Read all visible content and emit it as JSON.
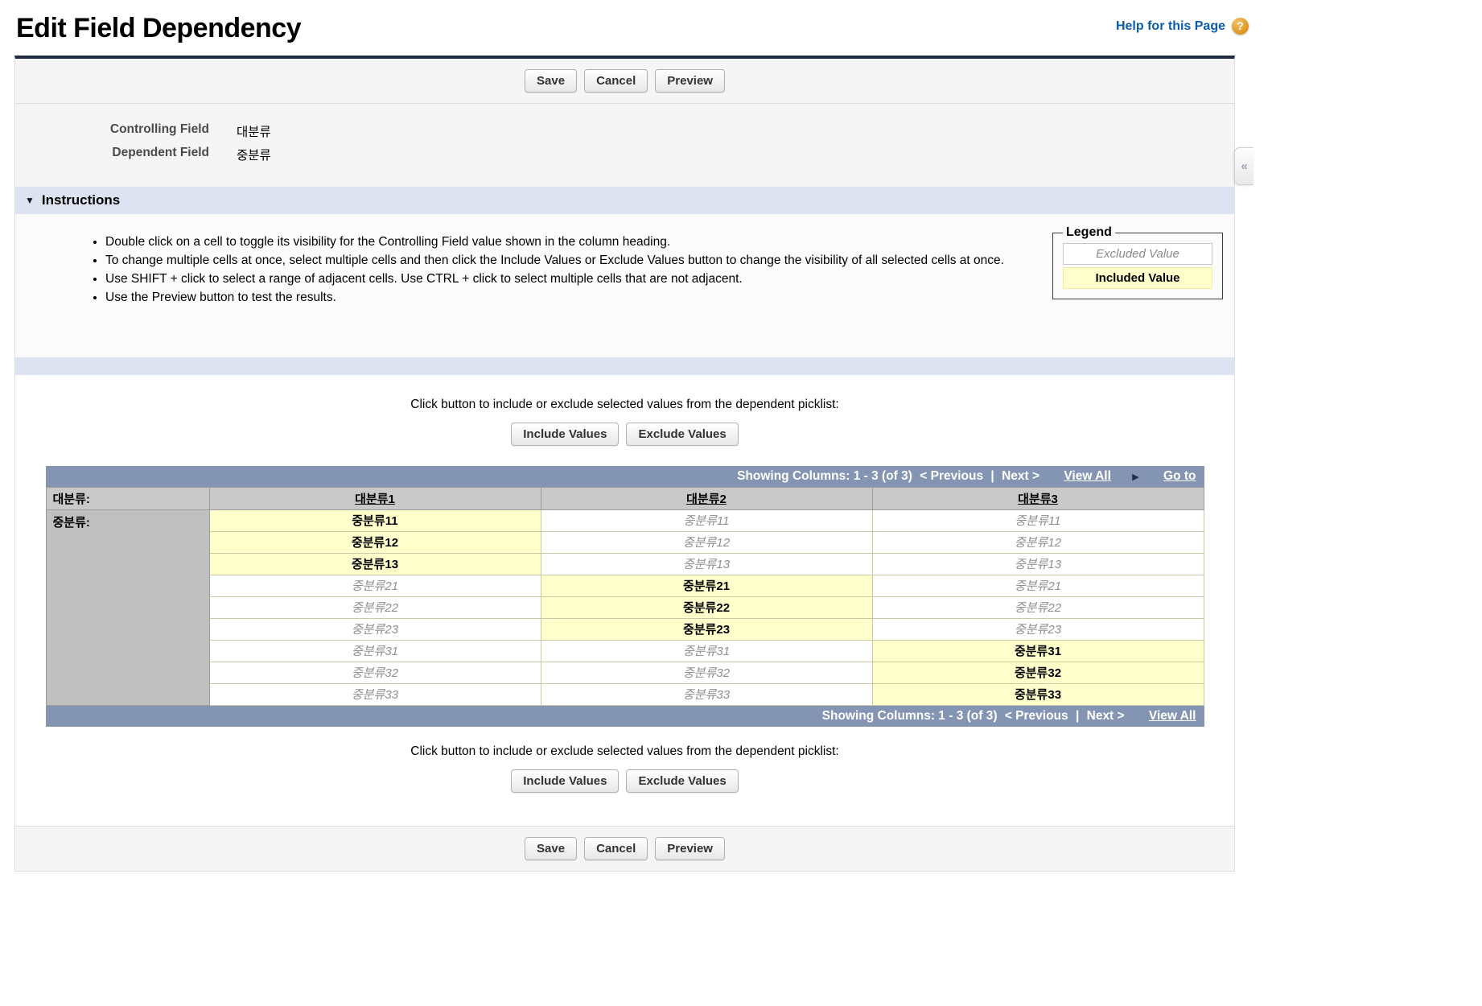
{
  "page": {
    "title": "Edit Field Dependency",
    "help_link": "Help for this Page",
    "help_icon": "?"
  },
  "buttons": {
    "save": "Save",
    "cancel": "Cancel",
    "preview": "Preview",
    "include": "Include Values",
    "exclude": "Exclude Values"
  },
  "fields": {
    "controlling_label": "Controlling Field",
    "controlling_value": "대분류",
    "dependent_label": "Dependent Field",
    "dependent_value": "중분류"
  },
  "instructions": {
    "header": "Instructions",
    "collapse_icon": "▼",
    "bullets": [
      "Double click on a cell to toggle its visibility for the Controlling Field value shown in the column heading.",
      "To change multiple cells at once, select multiple cells and then click the Include Values or Exclude Values button to change the visibility of all selected cells at once.",
      "Use SHIFT + click to select a range of adjacent cells. Use CTRL + click to select multiple cells that are not adjacent.",
      "Use the Preview button to test the results."
    ]
  },
  "legend": {
    "title": "Legend",
    "excluded": "Excluded Value",
    "included": "Included Value"
  },
  "picklist_prompt": "Click button to include or exclude selected values from the dependent picklist:",
  "table": {
    "showing": "Showing Columns: 1 - 3 (of 3)",
    "previous": "< Previous",
    "divider": "|",
    "next": "Next >",
    "view_all": "View All",
    "go_to": "Go to",
    "go_to_icon": "▶",
    "controlling_row_label": "대분류:",
    "dependent_row_label": "중분류:",
    "columns": [
      "대분류1",
      "대분류2",
      "대분류3"
    ],
    "rows": [
      {
        "value": "중분류11",
        "included": 0
      },
      {
        "value": "중분류12",
        "included": 0
      },
      {
        "value": "중분류13",
        "included": 0
      },
      {
        "value": "중분류21",
        "included": 1
      },
      {
        "value": "중분류22",
        "included": 1
      },
      {
        "value": "중분류23",
        "included": 1
      },
      {
        "value": "중분류31",
        "included": 2
      },
      {
        "value": "중분류32",
        "included": 2
      },
      {
        "value": "중분류33",
        "included": 2
      }
    ]
  },
  "side_tab_icon": "«",
  "colors": {
    "panel_top_border": "#1f2b40",
    "section_header_bg": "#dee3f2",
    "table_bar_bg": "#8495b4",
    "included_bg": "#ffffcc",
    "header_cell_bg": "#c9c9c9",
    "link_blue": "#0b5cab",
    "help_icon_orange": "#dd9422"
  }
}
